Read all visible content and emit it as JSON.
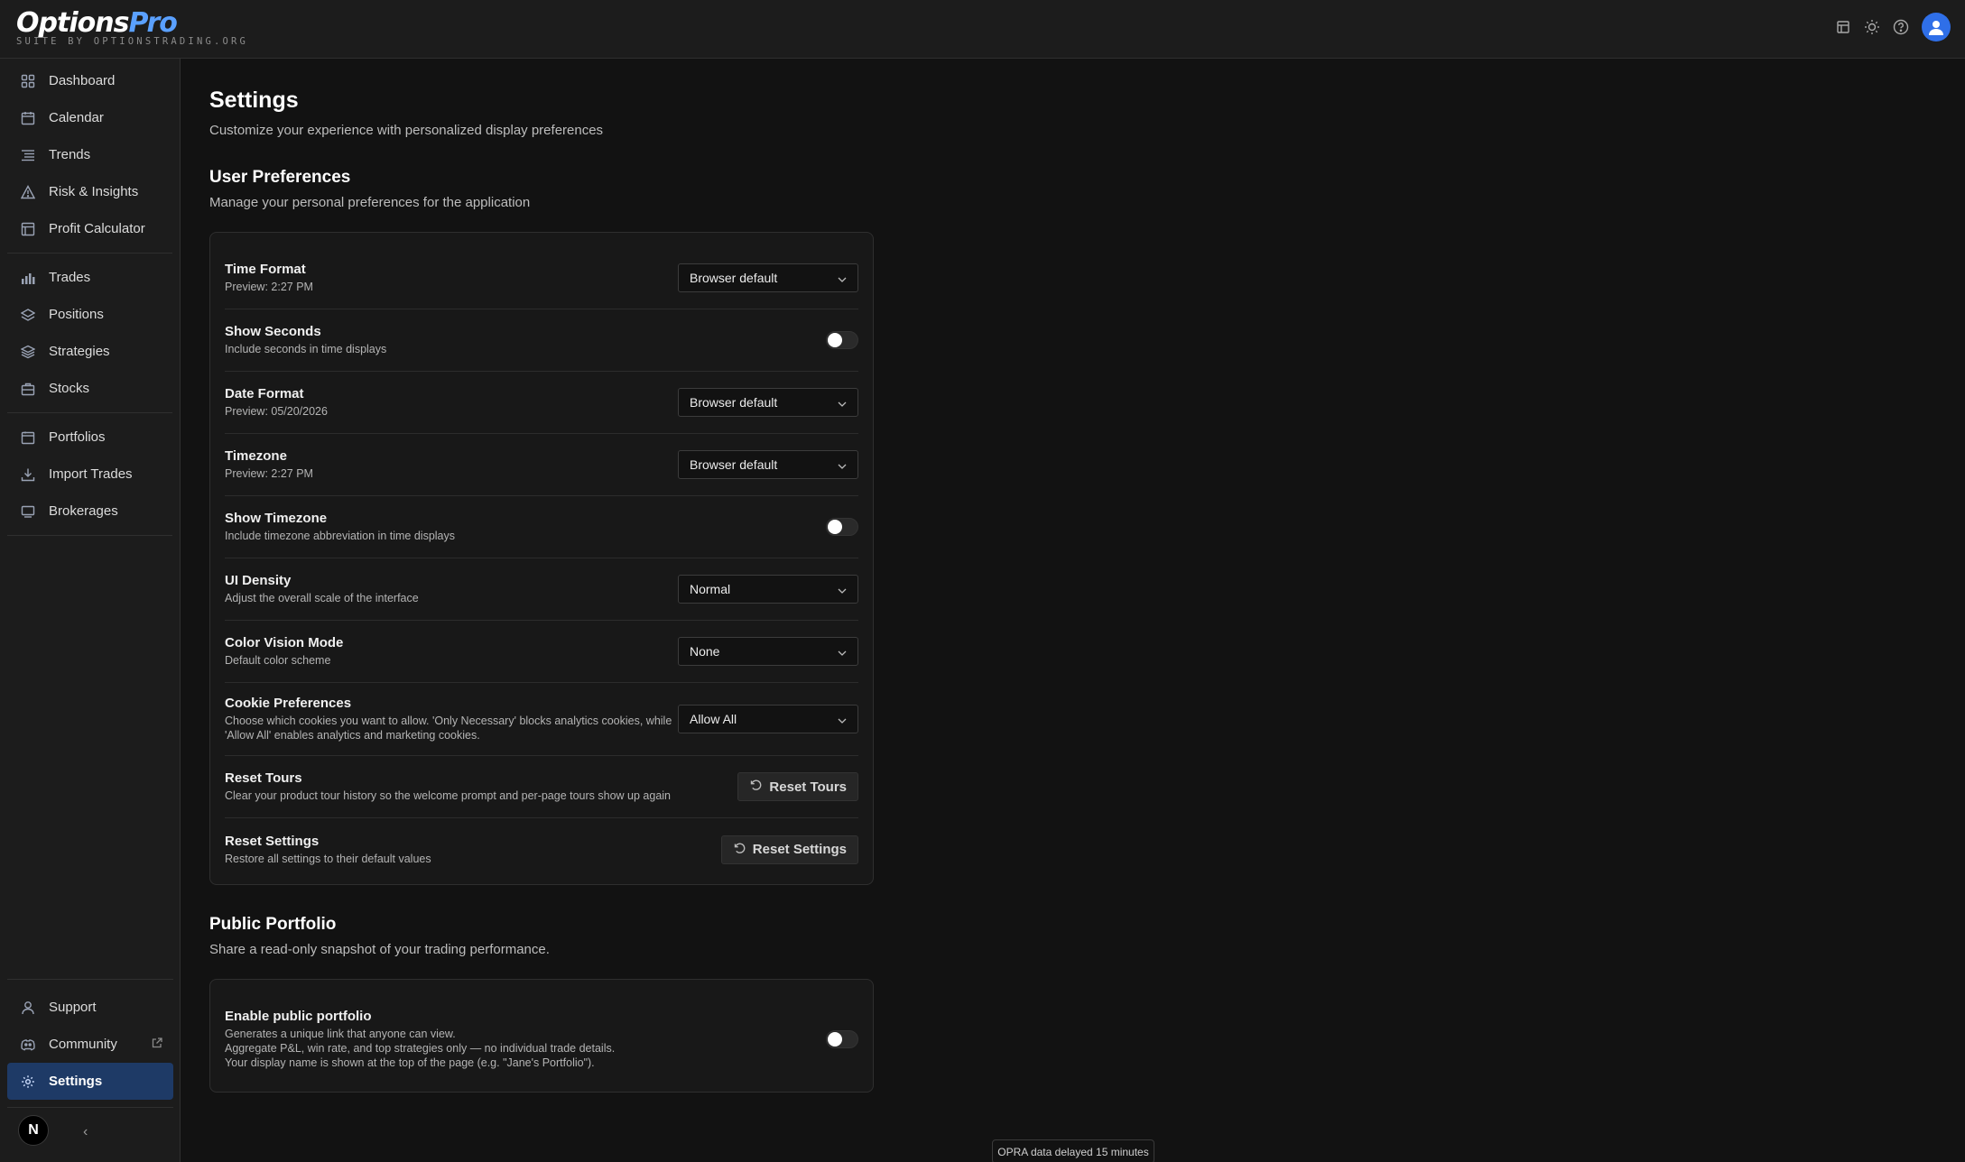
{
  "header": {
    "logo_main": "Options",
    "logo_accent": "Pro",
    "logo_tagline": "SUITE BY OPTIONSTRADING.ORG"
  },
  "sidebar": {
    "groups": [
      [
        {
          "label": "Dashboard",
          "icon": "grid-icon"
        },
        {
          "label": "Calendar",
          "icon": "calendar-icon"
        },
        {
          "label": "Trends",
          "icon": "list-icon"
        },
        {
          "label": "Risk & Insights",
          "icon": "warning-icon"
        },
        {
          "label": "Profit Calculator",
          "icon": "calculator-icon"
        }
      ],
      [
        {
          "label": "Trades",
          "icon": "bar-chart-icon"
        },
        {
          "label": "Positions",
          "icon": "layers-icon"
        },
        {
          "label": "Strategies",
          "icon": "stack-icon"
        },
        {
          "label": "Stocks",
          "icon": "briefcase-icon"
        }
      ],
      [
        {
          "label": "Portfolios",
          "icon": "folder-icon"
        },
        {
          "label": "Import Trades",
          "icon": "download-icon"
        },
        {
          "label": "Brokerages",
          "icon": "monitor-icon"
        }
      ]
    ],
    "bottom": [
      {
        "label": "Support",
        "icon": "user-icon"
      },
      {
        "label": "Community",
        "icon": "discord-icon"
      },
      {
        "label": "Settings",
        "icon": "gear-icon"
      }
    ],
    "badge": "N",
    "collapse": "‹"
  },
  "page": {
    "title": "Settings",
    "subtitle": "Customize your experience with personalized display preferences"
  },
  "user_prefs": {
    "title": "User Preferences",
    "subtitle": "Manage your personal preferences for the application",
    "time_format": {
      "label": "Time Format",
      "desc": "Preview: 2:27 PM",
      "value": "Browser default"
    },
    "show_seconds": {
      "label": "Show Seconds",
      "desc": "Include seconds in time displays",
      "on": false
    },
    "date_format": {
      "label": "Date Format",
      "desc": "Preview: 05/20/2026",
      "value": "Browser default"
    },
    "timezone": {
      "label": "Timezone",
      "desc": "Preview: 2:27 PM",
      "value": "Browser default"
    },
    "show_timezone": {
      "label": "Show Timezone",
      "desc": "Include timezone abbreviation in time displays",
      "on": false
    },
    "ui_density": {
      "label": "UI Density",
      "desc": "Adjust the overall scale of the interface",
      "value": "Normal"
    },
    "color_vision": {
      "label": "Color Vision Mode",
      "desc": "Default color scheme",
      "value": "None"
    },
    "cookies": {
      "label": "Cookie Preferences",
      "desc": "Choose which cookies you want to allow. 'Only Necessary' blocks analytics cookies, while 'Allow All' enables analytics and marketing cookies.",
      "value": "Allow All"
    },
    "reset_tours": {
      "label": "Reset Tours",
      "desc": "Clear your product tour history so the welcome prompt and per-page tours show up again",
      "button": "Reset Tours"
    },
    "reset_settings": {
      "label": "Reset Settings",
      "desc": "Restore all settings to their default values",
      "button": "Reset Settings"
    }
  },
  "public_portfolio": {
    "title": "Public Portfolio",
    "subtitle": "Share a read-only snapshot of your trading performance.",
    "enable": {
      "label": "Enable public portfolio",
      "desc_1": "Generates a unique link that anyone can view.",
      "desc_2": "Aggregate P&L, win rate, and top strategies only — no individual trade details.",
      "desc_3": "Your display name is shown at the top of the page (e.g. \"Jane's Portfolio\").",
      "on": false
    }
  },
  "footer": {
    "status": "OPRA data delayed 15 minutes"
  },
  "colors": {
    "accent": "#2f6fe8",
    "active_nav": "#1e3a66",
    "background": "#121212"
  }
}
